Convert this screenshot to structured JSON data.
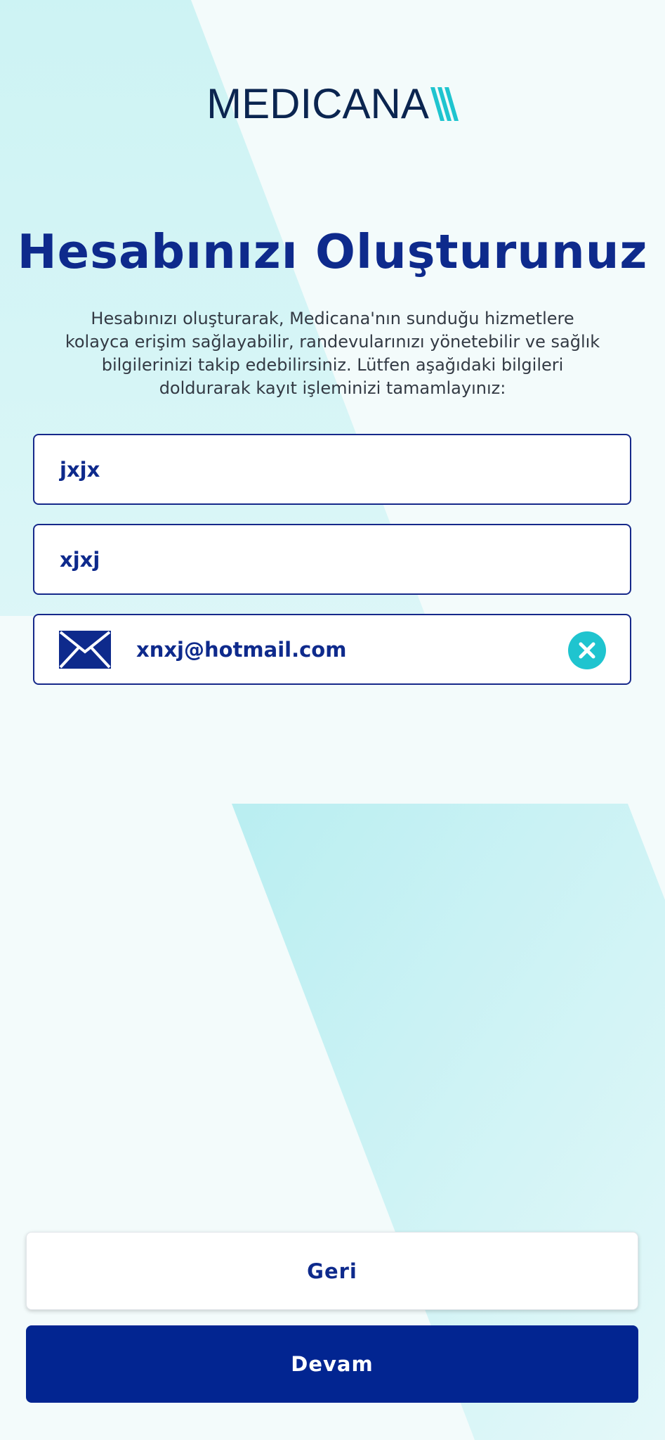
{
  "logo": {
    "text": "MEDICANA",
    "mark_color": "#1fc4cf"
  },
  "header": {
    "title": "Hesabınızı Oluşturunuz",
    "description": "Hesabınızı oluşturarak, Medicana'nın sunduğu hizmetlere kolayca erişim sağlayabilir, randevularınızı yönetebilir ve sağlık bilgilerinizi takip edebilirsiniz. Lütfen aşağıdaki bilgileri doldurarak kayıt işleminizi tamamlayınız:"
  },
  "form": {
    "first_name_value": "jxjx",
    "last_name_value": "xjxj",
    "email_value": "xnxj@hotmail.com",
    "email_icon": "envelope-icon",
    "clear_icon": "clear-icon"
  },
  "buttons": {
    "back_label": "Geri",
    "continue_label": "Devam"
  },
  "colors": {
    "primary": "#022591",
    "accent": "#1fc4cf",
    "background": "#f3fbfb"
  }
}
